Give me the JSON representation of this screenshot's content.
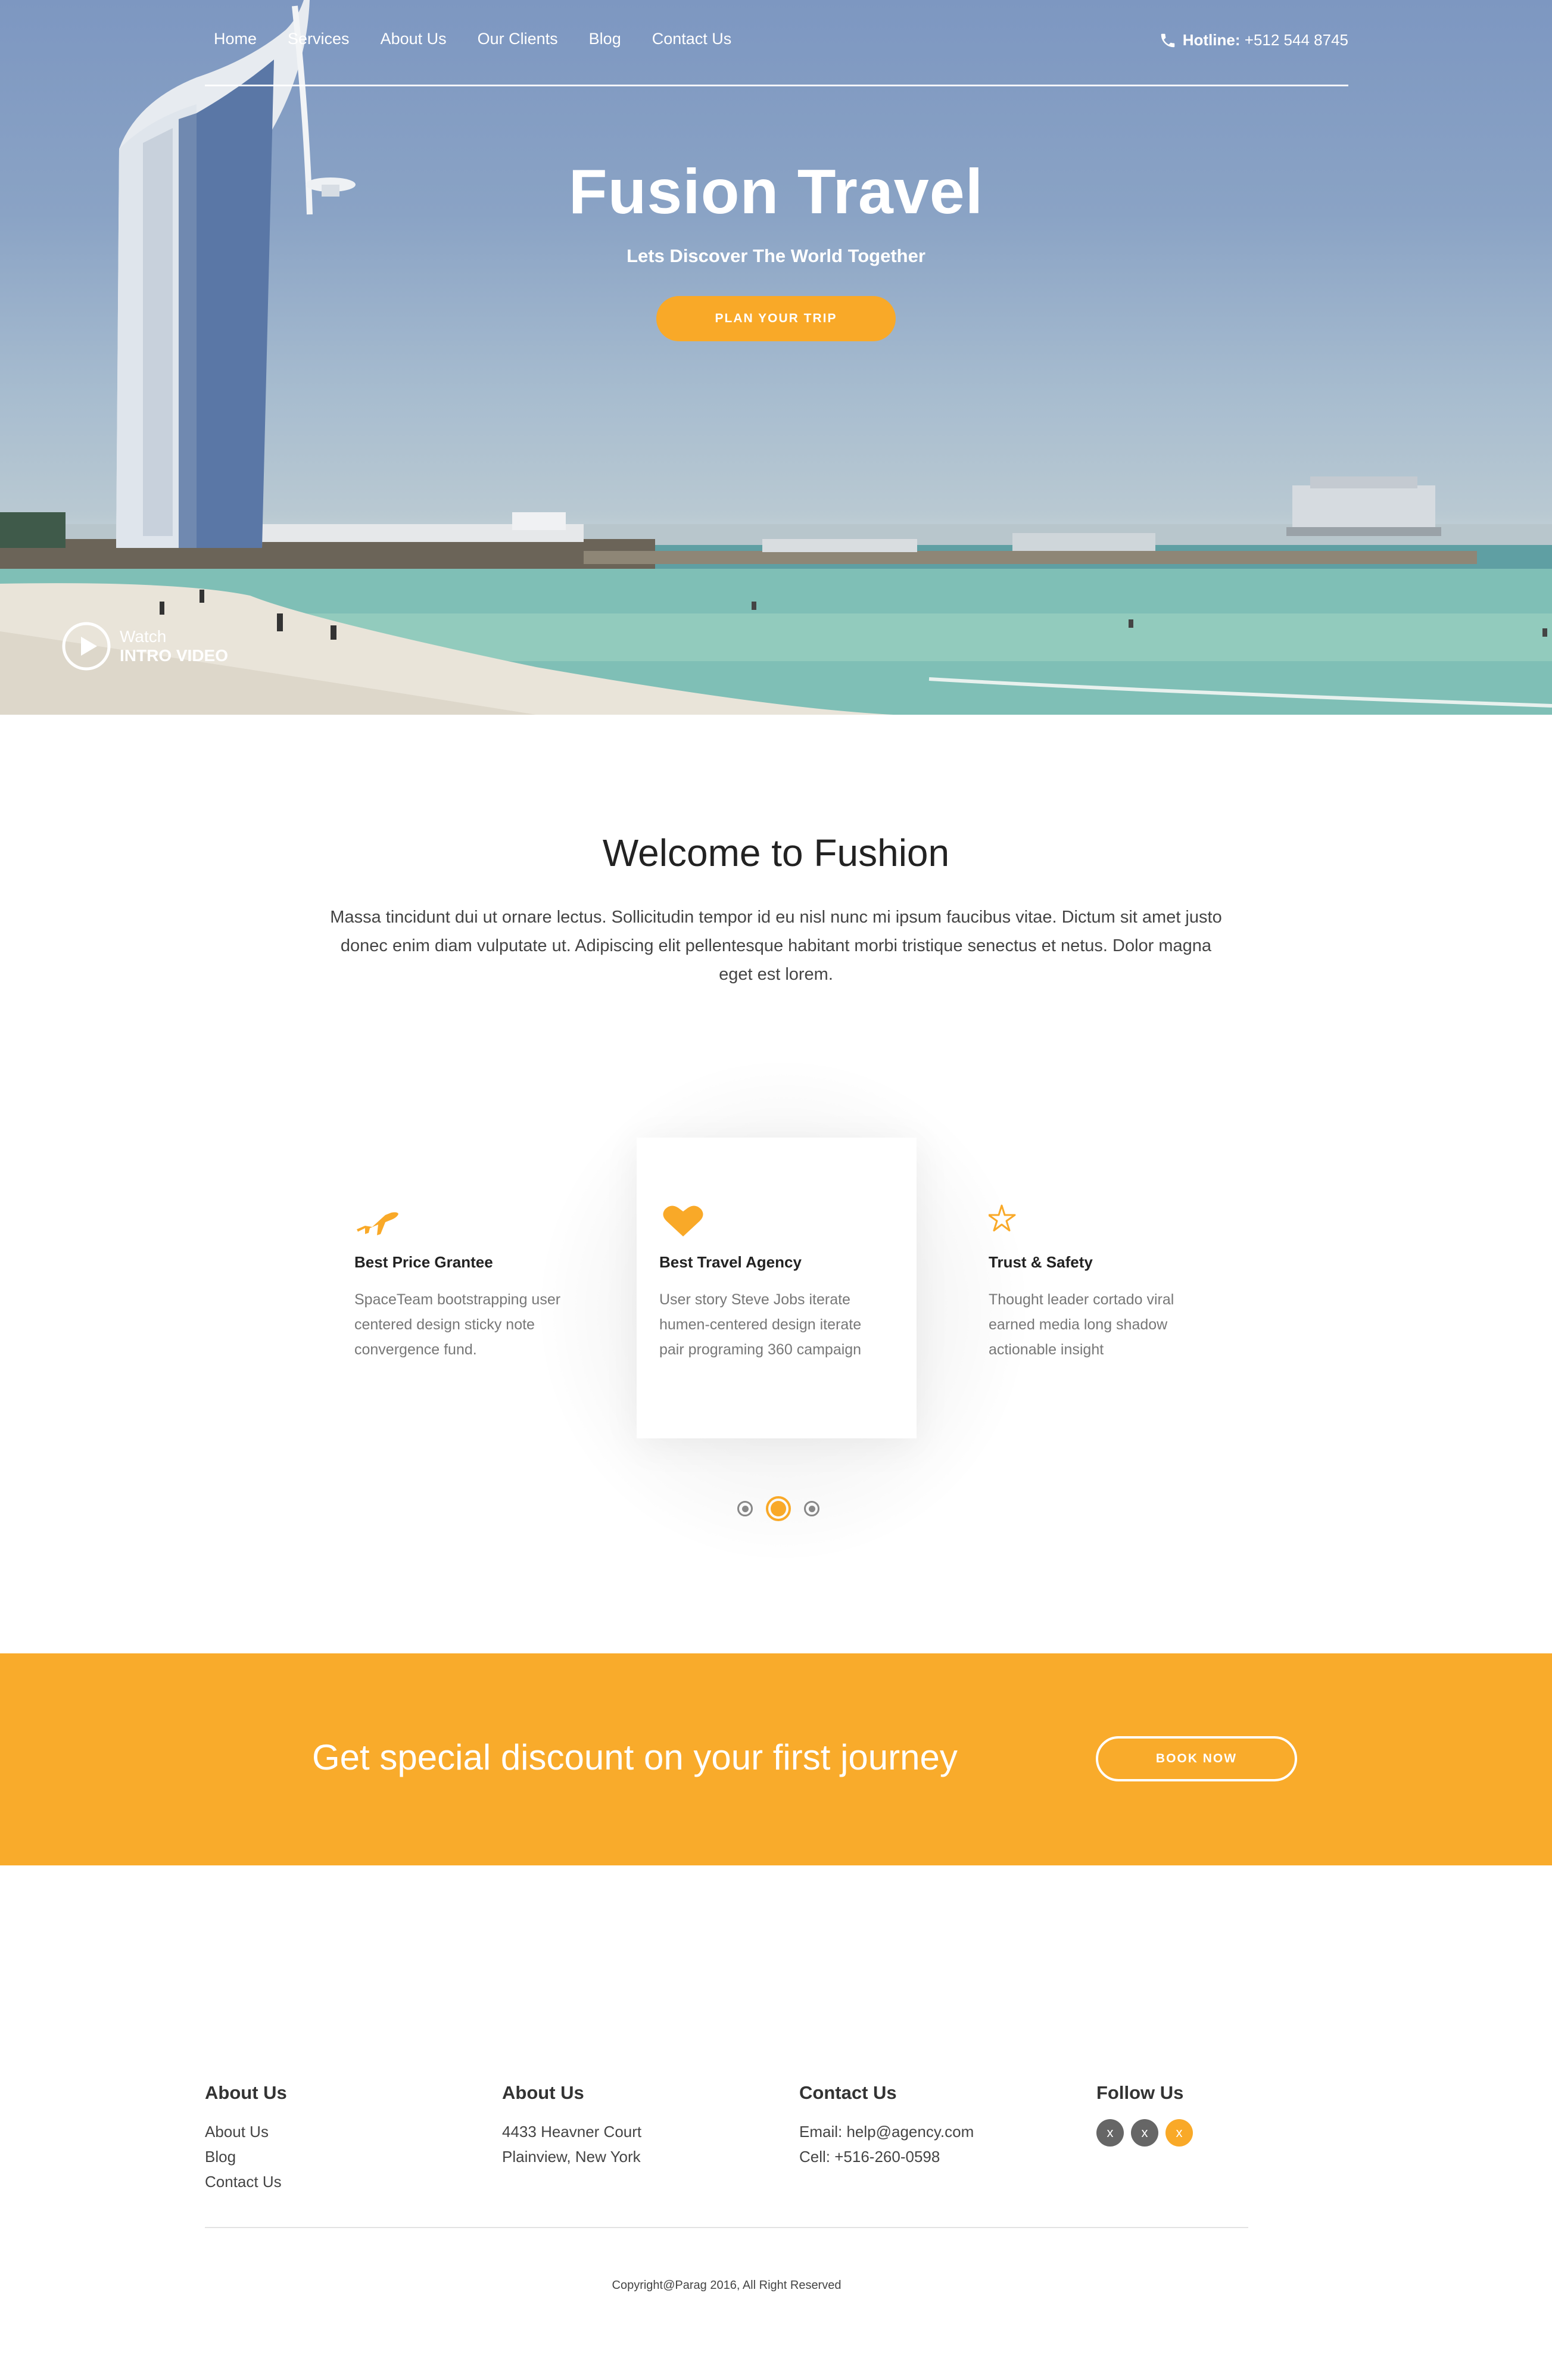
{
  "nav": {
    "links": [
      "Home",
      "Services",
      "About Us",
      "Our Clients",
      "Blog",
      "Contact Us"
    ],
    "hotline_label": "Hotline:",
    "hotline_number": "+512 544 8745"
  },
  "hero": {
    "title": "Fusion Travel",
    "subtitle": "Lets Discover The World Together",
    "button": "PLAN YOUR TRIP",
    "video_line1": "Watch",
    "video_line2": "INTRO VIDEO"
  },
  "welcome": {
    "title": "Welcome to Fushion",
    "text": "Massa tincidunt dui ut ornare lectus. Sollicitudin tempor id eu nisl nunc mi ipsum faucibus vitae. Dictum sit amet justo donec enim diam vulputate ut. Adipiscing elit pellentesque habitant morbi tristique senectus et netus. Dolor magna eget est lorem."
  },
  "features": [
    {
      "icon": "airplane-icon",
      "title": "Best Price Grantee",
      "text": "SpaceTeam bootstrapping user centered design sticky note convergence fund."
    },
    {
      "icon": "heart-icon",
      "title": "Best Travel Agency",
      "text": "User story Steve Jobs iterate humen-centered design iterate pair programing 360 campaign"
    },
    {
      "icon": "star-icon",
      "title": "Trust & Safety",
      "text": "Thought leader cortado viral earned media long shadow actionable insight"
    }
  ],
  "carousel": {
    "count": 3,
    "active": 1
  },
  "cta": {
    "text": "Get special discount on your first journey",
    "button": "BOOK NOW"
  },
  "footer": {
    "col1": {
      "title": "About Us",
      "links": [
        "About Us",
        "Blog",
        "Contact Us"
      ]
    },
    "col2": {
      "title": "About Us",
      "lines": [
        "4433 Heavner Court",
        "Plainview, New York"
      ]
    },
    "col3": {
      "title": "Contact Us",
      "lines": [
        "Email: help@agency.com",
        "Cell: +516-260-0598"
      ]
    },
    "col4": {
      "title": "Follow Us",
      "social": [
        "x",
        "x",
        "x"
      ]
    },
    "copyright": "Copyright@Parag 2016, All Right Reserved"
  },
  "colors": {
    "accent": "#f9a928",
    "cta_bg": "#f9ab2b",
    "text_dark": "#222222",
    "text_muted": "#777777"
  }
}
